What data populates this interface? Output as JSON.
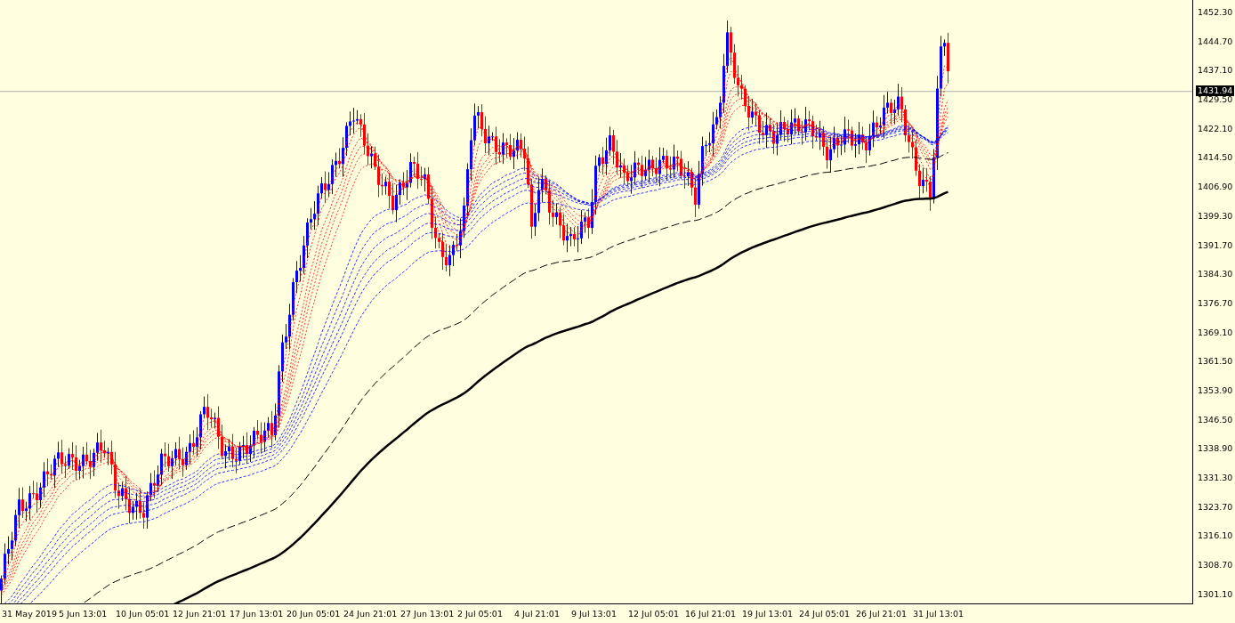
{
  "price_axis": {
    "labels": [
      "1452.30",
      "1444.70",
      "1437.10",
      "1429.50",
      "1422.10",
      "1414.50",
      "1406.90",
      "1399.30",
      "1391.70",
      "1384.30",
      "1376.70",
      "1369.10",
      "1361.50",
      "1353.90",
      "1346.50",
      "1338.90",
      "1331.30",
      "1323.70",
      "1316.10",
      "1308.70",
      "1301.10"
    ]
  },
  "current_price": {
    "label": "1431.94"
  },
  "time_axis": {
    "labels": [
      "31 May 2019",
      "5 Jun 13:01",
      "10 Jun 05:01",
      "12 Jun 21:01",
      "17 Jun 13:01",
      "20 Jun 05:01",
      "24 Jun 21:01",
      "27 Jun 13:01",
      "2 Jul 05:01",
      "4 Jul 21:01",
      "9 Jul 13:01",
      "12 Jul 05:01",
      "16 Jul 21:01",
      "19 Jul 13:01",
      "24 Jul 05:01",
      "26 Jul 21:01",
      "31 Jul 13:01"
    ]
  }
}
